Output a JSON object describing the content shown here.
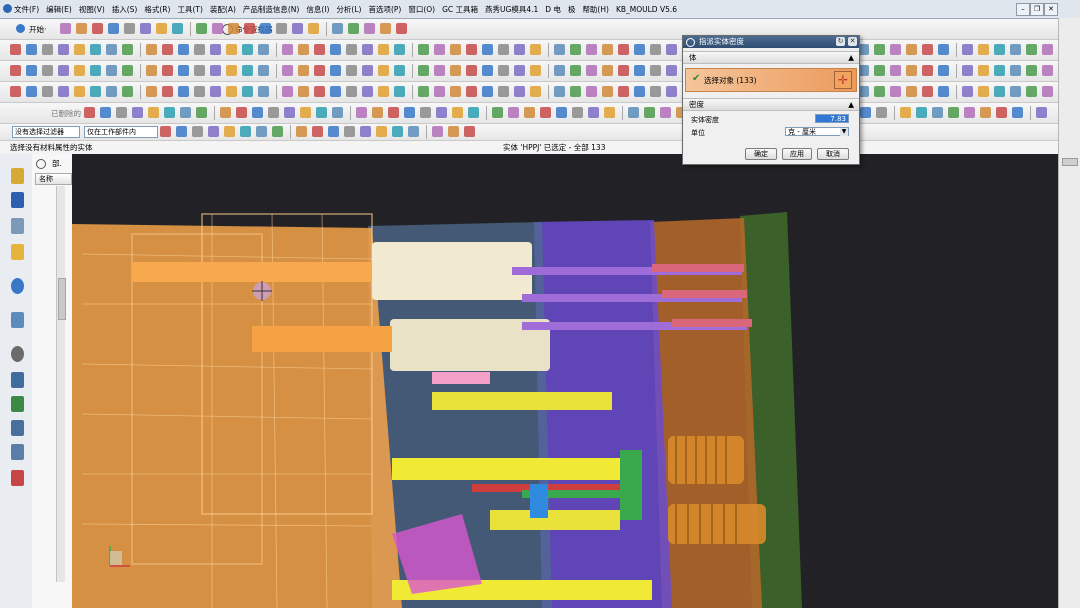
{
  "menu": {
    "items": [
      "文件(F)",
      "编辑(E)",
      "视图(V)",
      "插入(S)",
      "格式(R)",
      "工具(T)",
      "装配(A)",
      "产品制造信息(N)",
      "信息(I)",
      "分析(L)",
      "首选项(P)",
      "窗口(O)",
      "GC 工具箱",
      "燕秀UG模具4.1",
      "D 电",
      "极",
      "帮助(H)",
      "KB_MOULD V5.6"
    ]
  },
  "toolbar": {
    "start_label": "开始·",
    "command_finder_label": "命令查找器",
    "selection_filter": "没有选择过滤器",
    "scope": "仅在工作部件内",
    "deleted_label": "已删除的"
  },
  "status": {
    "prompt": "选择没有材料属性的实体",
    "selection_info": "实体 'HPPJ' 已选定 - 全部 133"
  },
  "nav": {
    "tab": "部.",
    "column_header": "名称"
  },
  "dialog": {
    "title": "指派实体密度",
    "section_body": "体",
    "select_object": "选择对象 (133)",
    "section_density": "密度",
    "density_label": "实体密度",
    "density_value": "7.83",
    "unit_label": "单位",
    "unit_value": "克 - 厘米",
    "ok": "确定",
    "apply": "应用",
    "cancel": "取消"
  },
  "colors": {
    "accent_orange": "#f7a84a",
    "selection_row": "#f0a060",
    "viewport_bg": "#222226",
    "dialog_title": "#3a587e"
  }
}
